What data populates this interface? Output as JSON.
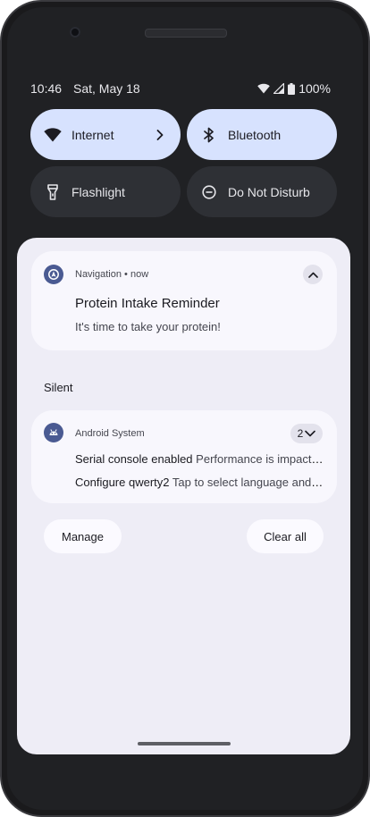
{
  "status": {
    "time": "10:46",
    "date": "Sat, May 18",
    "battery": "100%",
    "icons": [
      "wifi-icon",
      "cell-signal-icon",
      "battery-icon"
    ]
  },
  "quick_settings": [
    {
      "label": "Internet",
      "icon": "wifi-icon",
      "state": "on",
      "has_chevron": true
    },
    {
      "label": "Bluetooth",
      "icon": "bluetooth-icon",
      "state": "on",
      "has_chevron": false
    },
    {
      "label": "Flashlight",
      "icon": "flashlight-icon",
      "state": "off",
      "has_chevron": false
    },
    {
      "label": "Do Not Disturb",
      "icon": "do-not-disturb-icon",
      "state": "off",
      "has_chevron": false
    }
  ],
  "notifications": {
    "primary": {
      "app": "Navigation",
      "time": "now",
      "separator": "•",
      "title": "Protein Intake Reminder",
      "text": "It's time to take your protein!"
    },
    "silent_label": "Silent",
    "system": {
      "app": "Android System",
      "count": "2",
      "items": [
        {
          "title": "Serial console enabled",
          "text": "Performance is impacted. To disable, check bootloader."
        },
        {
          "title": "Configure qwerty2",
          "text": "Tap to select language and layout"
        }
      ]
    }
  },
  "actions": {
    "manage": "Manage",
    "clear_all": "Clear all"
  },
  "colors": {
    "tile_on": "#d7e2fe",
    "tile_off": "#2e3035",
    "shade_bg": "#eeedf6",
    "card_bg": "#f8f7fd",
    "app_icon": "#4a5a92"
  }
}
